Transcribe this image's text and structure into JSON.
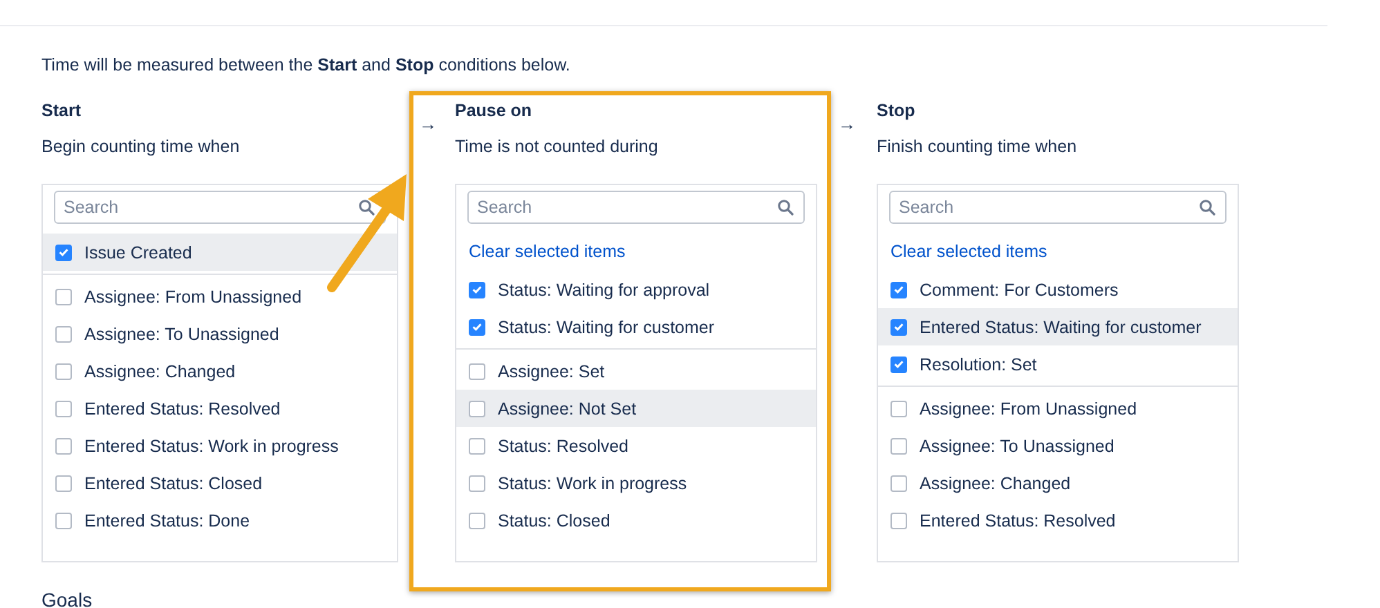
{
  "intro": "Time will be measured between the **Start** and **Stop** conditions below.",
  "columns": [
    {
      "title": "Start",
      "subtitle": "Begin counting time when",
      "highlighted": false,
      "search": {
        "placeholder": "Search"
      },
      "items": [
        {
          "label": "Issue Created",
          "checked": true,
          "hovered": true
        },
        {
          "label": "Assignee: From Unassigned",
          "checked": false,
          "hovered": false
        },
        {
          "label": "Assignee: To Unassigned",
          "checked": false,
          "hovered": false
        },
        {
          "label": "Assignee: Changed",
          "checked": false,
          "hovered": false
        },
        {
          "label": "Entered Status: Resolved",
          "checked": false,
          "hovered": false
        },
        {
          "label": "Entered Status: Work in progress",
          "checked": false,
          "hovered": false
        },
        {
          "label": "Entered Status: Closed",
          "checked": false,
          "hovered": false
        },
        {
          "label": "Entered Status: Done",
          "checked": false,
          "hovered": false
        }
      ]
    },
    {
      "arrow": "→",
      "title": "Pause on",
      "subtitle": "Time is not counted during",
      "highlighted": true,
      "search": {
        "placeholder": "Search"
      },
      "clear_link": "Clear selected items",
      "items": [
        {
          "label": "Status: Waiting for approval",
          "checked": true,
          "hovered": false
        },
        {
          "label": "Status: Waiting for customer",
          "checked": true,
          "hovered": false
        },
        {
          "label": "Assignee: Set",
          "checked": false,
          "hovered": false
        },
        {
          "label": "Assignee: Not Set",
          "checked": false,
          "hovered": true
        },
        {
          "label": "Status: Resolved",
          "checked": false,
          "hovered": false
        },
        {
          "label": "Status: Work in progress",
          "checked": false,
          "hovered": false
        },
        {
          "label": "Status: Closed",
          "checked": false,
          "hovered": false
        }
      ]
    },
    {
      "arrow": "→",
      "title": "Stop",
      "subtitle": "Finish counting time when",
      "highlighted": false,
      "search": {
        "placeholder": "Search"
      },
      "clear_link": "Clear selected items",
      "items": [
        {
          "label": "Comment: For Customers",
          "checked": true,
          "hovered": false
        },
        {
          "label": "Entered Status: Waiting for customer",
          "checked": true,
          "hovered": true
        },
        {
          "label": "Resolution: Set",
          "checked": true,
          "hovered": false
        },
        {
          "label": "Assignee: From Unassigned",
          "checked": false,
          "hovered": false
        },
        {
          "label": "Assignee: To Unassigned",
          "checked": false,
          "hovered": false
        },
        {
          "label": "Assignee: Changed",
          "checked": false,
          "hovered": false
        },
        {
          "label": "Entered Status: Resolved",
          "checked": false,
          "hovered": false
        }
      ]
    }
  ],
  "goals": "Goals"
}
